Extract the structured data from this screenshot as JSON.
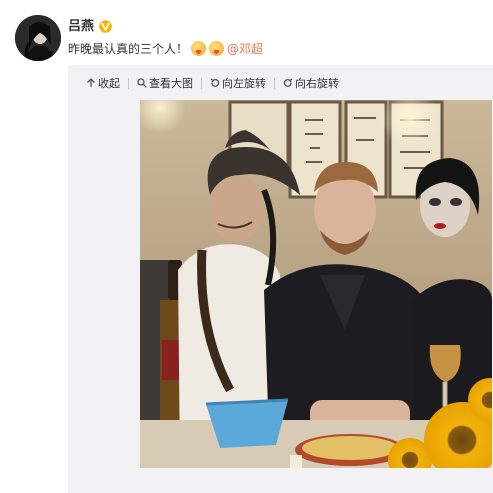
{
  "post": {
    "author": {
      "name": "吕燕",
      "verified_badge": "V"
    },
    "text": "昨晚最认真的三个人！",
    "emojis": [
      "smile-emoji",
      "smile-emoji"
    ],
    "mention": "@邓超"
  },
  "toolbar": {
    "collapse_label": "收起",
    "view_large_label": "查看大图",
    "rotate_left_label": "向左旋转",
    "rotate_right_label": "向右旋转",
    "collapse_icon": "arrow-up-icon",
    "view_large_icon": "magnifier-icon",
    "rotate_left_icon": "rotate-left-icon",
    "rotate_right_icon": "rotate-right-icon"
  },
  "colors": {
    "author_name": "#333333",
    "mention": "#eb7350",
    "verified_badge": "#f7b500",
    "media_panel_bg": "#f2f2f5"
  }
}
